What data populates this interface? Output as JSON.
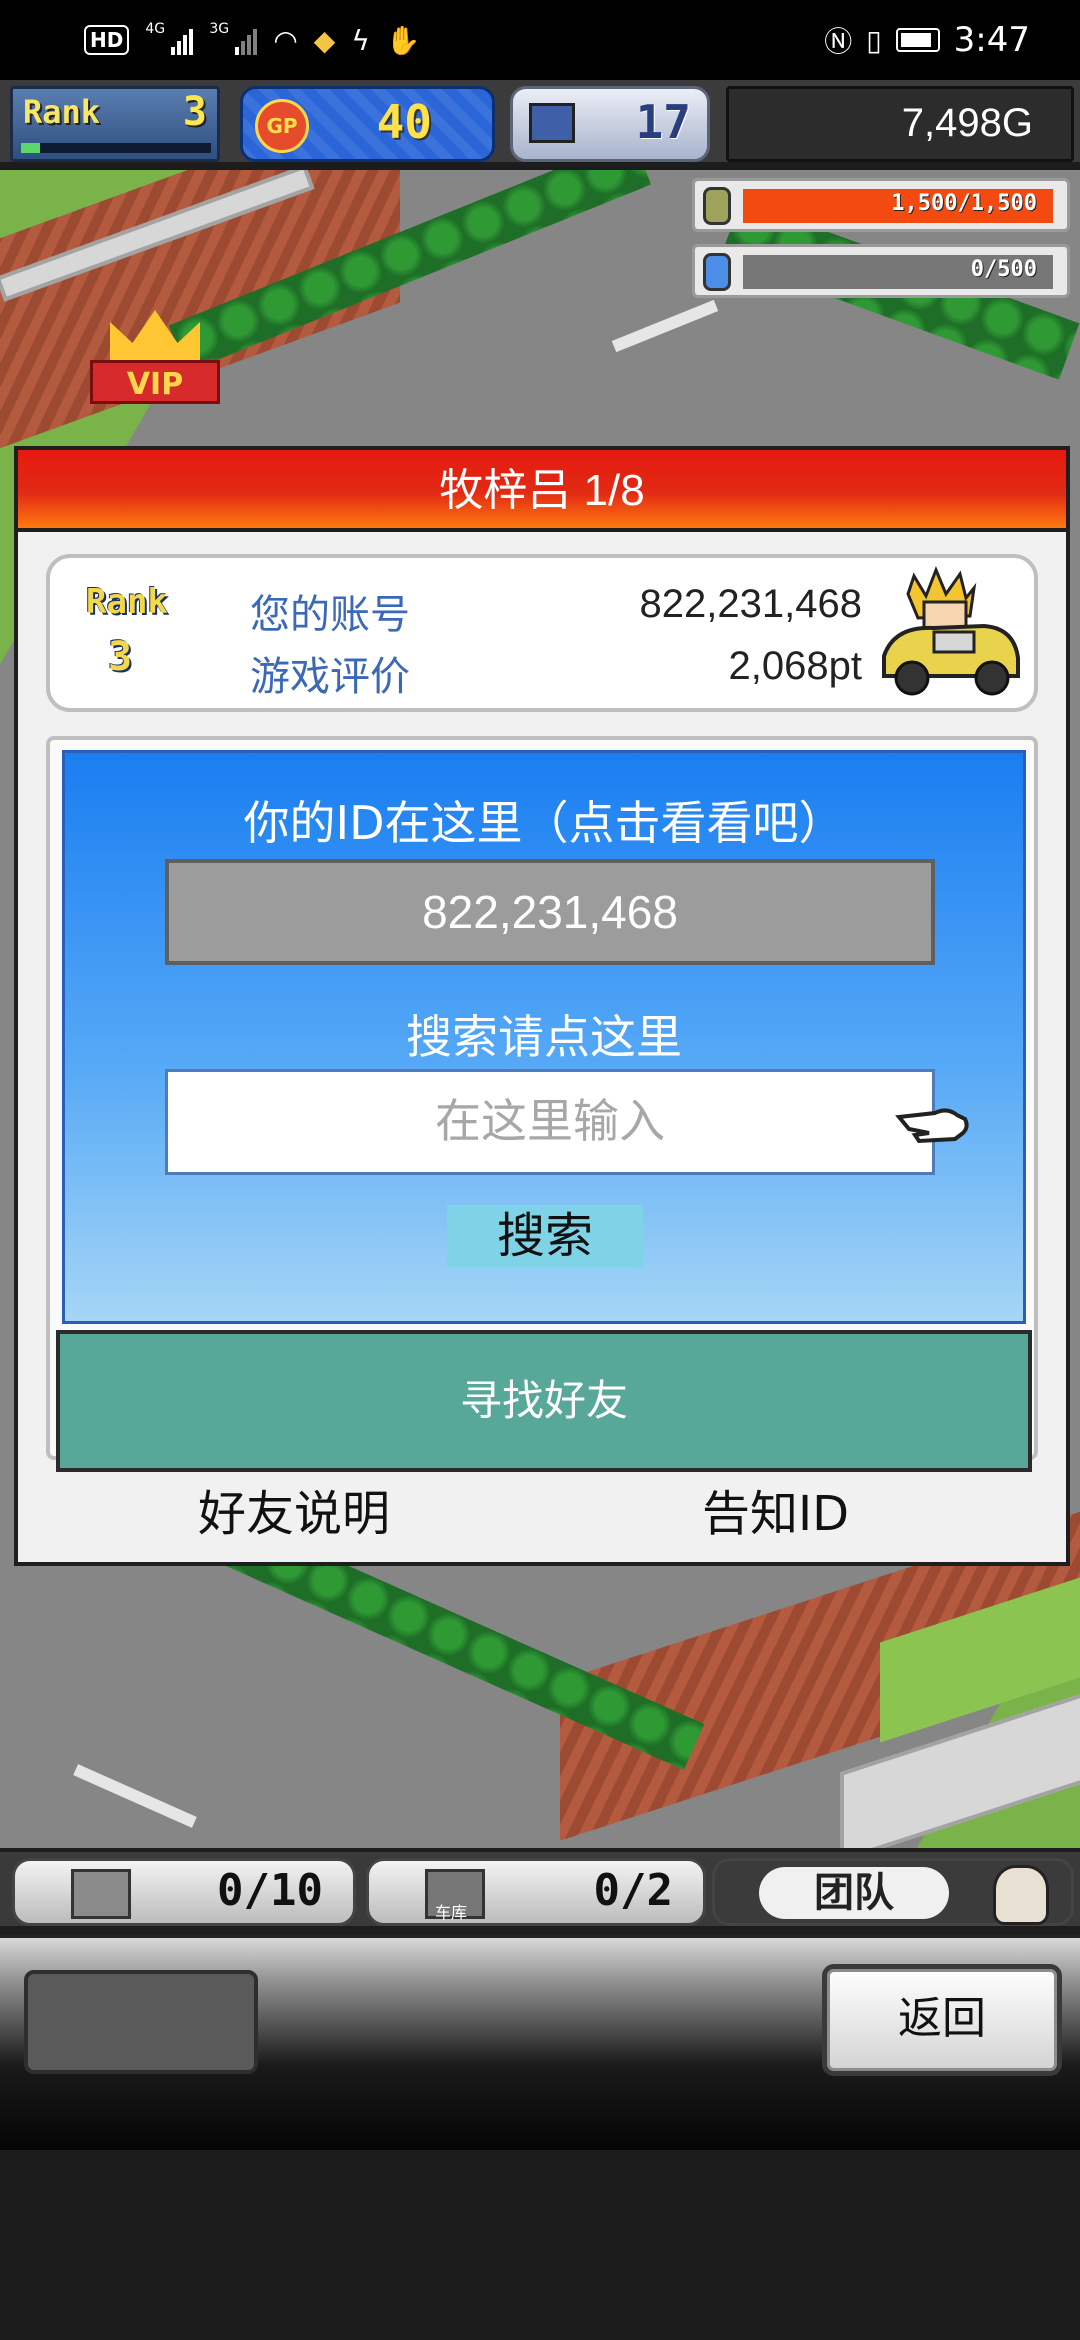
{
  "status_bar": {
    "left_badge": "HD",
    "signal_1": "4G",
    "signal_2": "3G",
    "time": "3:47"
  },
  "hud": {
    "rank_label": "Rank",
    "rank_value": "3",
    "rank_progress": 0.1,
    "gp_label": "GP",
    "gp_value": "40",
    "pc_value": "17",
    "money": "7,498G",
    "fuel_gauge": {
      "text": "1,500/1,500",
      "fraction": 1.0,
      "color": "#f24a10"
    },
    "oil_gauge": {
      "text": "0/500",
      "fraction": 0.0,
      "color": "#9a9a9a"
    },
    "vip_label": "VIP"
  },
  "dialog": {
    "title": "牧梓吕 1/8",
    "card": {
      "rank_label": "Rank",
      "rank_value": "3",
      "account_label": "您的账号",
      "account_value": "822,231,468",
      "rating_label": "游戏评价",
      "rating_value": "2,068pt"
    },
    "id_label": "你的ID在这里（点击看看吧）",
    "id_value": "822,231,468",
    "search_label": "搜索请点这里",
    "search_placeholder": "在这里输入",
    "search_button": "搜索",
    "find_friends_button": "寻找好友",
    "friend_help_link": "好友说明",
    "share_id_link": "告知ID"
  },
  "bottom": {
    "slot1_value": "0/10",
    "slot2_label": "车库",
    "slot2_value": "0/2",
    "team_label": "团队",
    "back_button": "返回"
  },
  "colors": {
    "title_red": "#e51a10",
    "blue_panel": "#1a7ef1",
    "friend_button": "#58a89a",
    "search_button": "#7fd3e6"
  }
}
